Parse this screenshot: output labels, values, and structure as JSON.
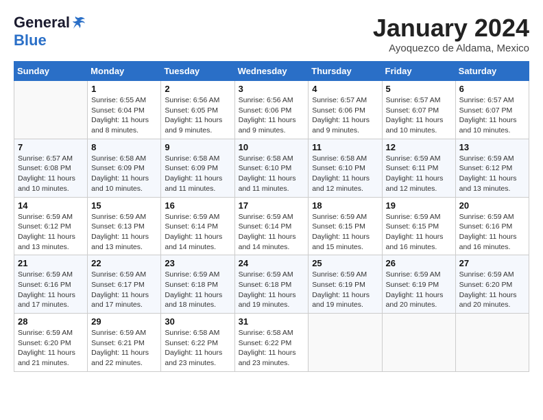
{
  "logo": {
    "general": "General",
    "blue": "Blue"
  },
  "title": "January 2024",
  "location": "Ayoquezco de Aldama, Mexico",
  "weekdays": [
    "Sunday",
    "Monday",
    "Tuesday",
    "Wednesday",
    "Thursday",
    "Friday",
    "Saturday"
  ],
  "weeks": [
    [
      {
        "day": "",
        "sunrise": "",
        "sunset": "",
        "daylight": ""
      },
      {
        "day": "1",
        "sunrise": "Sunrise: 6:55 AM",
        "sunset": "Sunset: 6:04 PM",
        "daylight": "Daylight: 11 hours and 8 minutes."
      },
      {
        "day": "2",
        "sunrise": "Sunrise: 6:56 AM",
        "sunset": "Sunset: 6:05 PM",
        "daylight": "Daylight: 11 hours and 9 minutes."
      },
      {
        "day": "3",
        "sunrise": "Sunrise: 6:56 AM",
        "sunset": "Sunset: 6:06 PM",
        "daylight": "Daylight: 11 hours and 9 minutes."
      },
      {
        "day": "4",
        "sunrise": "Sunrise: 6:57 AM",
        "sunset": "Sunset: 6:06 PM",
        "daylight": "Daylight: 11 hours and 9 minutes."
      },
      {
        "day": "5",
        "sunrise": "Sunrise: 6:57 AM",
        "sunset": "Sunset: 6:07 PM",
        "daylight": "Daylight: 11 hours and 10 minutes."
      },
      {
        "day": "6",
        "sunrise": "Sunrise: 6:57 AM",
        "sunset": "Sunset: 6:07 PM",
        "daylight": "Daylight: 11 hours and 10 minutes."
      }
    ],
    [
      {
        "day": "7",
        "sunrise": "Sunrise: 6:57 AM",
        "sunset": "Sunset: 6:08 PM",
        "daylight": "Daylight: 11 hours and 10 minutes."
      },
      {
        "day": "8",
        "sunrise": "Sunrise: 6:58 AM",
        "sunset": "Sunset: 6:09 PM",
        "daylight": "Daylight: 11 hours and 10 minutes."
      },
      {
        "day": "9",
        "sunrise": "Sunrise: 6:58 AM",
        "sunset": "Sunset: 6:09 PM",
        "daylight": "Daylight: 11 hours and 11 minutes."
      },
      {
        "day": "10",
        "sunrise": "Sunrise: 6:58 AM",
        "sunset": "Sunset: 6:10 PM",
        "daylight": "Daylight: 11 hours and 11 minutes."
      },
      {
        "day": "11",
        "sunrise": "Sunrise: 6:58 AM",
        "sunset": "Sunset: 6:10 PM",
        "daylight": "Daylight: 11 hours and 12 minutes."
      },
      {
        "day": "12",
        "sunrise": "Sunrise: 6:59 AM",
        "sunset": "Sunset: 6:11 PM",
        "daylight": "Daylight: 11 hours and 12 minutes."
      },
      {
        "day": "13",
        "sunrise": "Sunrise: 6:59 AM",
        "sunset": "Sunset: 6:12 PM",
        "daylight": "Daylight: 11 hours and 13 minutes."
      }
    ],
    [
      {
        "day": "14",
        "sunrise": "Sunrise: 6:59 AM",
        "sunset": "Sunset: 6:12 PM",
        "daylight": "Daylight: 11 hours and 13 minutes."
      },
      {
        "day": "15",
        "sunrise": "Sunrise: 6:59 AM",
        "sunset": "Sunset: 6:13 PM",
        "daylight": "Daylight: 11 hours and 13 minutes."
      },
      {
        "day": "16",
        "sunrise": "Sunrise: 6:59 AM",
        "sunset": "Sunset: 6:14 PM",
        "daylight": "Daylight: 11 hours and 14 minutes."
      },
      {
        "day": "17",
        "sunrise": "Sunrise: 6:59 AM",
        "sunset": "Sunset: 6:14 PM",
        "daylight": "Daylight: 11 hours and 14 minutes."
      },
      {
        "day": "18",
        "sunrise": "Sunrise: 6:59 AM",
        "sunset": "Sunset: 6:15 PM",
        "daylight": "Daylight: 11 hours and 15 minutes."
      },
      {
        "day": "19",
        "sunrise": "Sunrise: 6:59 AM",
        "sunset": "Sunset: 6:15 PM",
        "daylight": "Daylight: 11 hours and 16 minutes."
      },
      {
        "day": "20",
        "sunrise": "Sunrise: 6:59 AM",
        "sunset": "Sunset: 6:16 PM",
        "daylight": "Daylight: 11 hours and 16 minutes."
      }
    ],
    [
      {
        "day": "21",
        "sunrise": "Sunrise: 6:59 AM",
        "sunset": "Sunset: 6:16 PM",
        "daylight": "Daylight: 11 hours and 17 minutes."
      },
      {
        "day": "22",
        "sunrise": "Sunrise: 6:59 AM",
        "sunset": "Sunset: 6:17 PM",
        "daylight": "Daylight: 11 hours and 17 minutes."
      },
      {
        "day": "23",
        "sunrise": "Sunrise: 6:59 AM",
        "sunset": "Sunset: 6:18 PM",
        "daylight": "Daylight: 11 hours and 18 minutes."
      },
      {
        "day": "24",
        "sunrise": "Sunrise: 6:59 AM",
        "sunset": "Sunset: 6:18 PM",
        "daylight": "Daylight: 11 hours and 19 minutes."
      },
      {
        "day": "25",
        "sunrise": "Sunrise: 6:59 AM",
        "sunset": "Sunset: 6:19 PM",
        "daylight": "Daylight: 11 hours and 19 minutes."
      },
      {
        "day": "26",
        "sunrise": "Sunrise: 6:59 AM",
        "sunset": "Sunset: 6:19 PM",
        "daylight": "Daylight: 11 hours and 20 minutes."
      },
      {
        "day": "27",
        "sunrise": "Sunrise: 6:59 AM",
        "sunset": "Sunset: 6:20 PM",
        "daylight": "Daylight: 11 hours and 20 minutes."
      }
    ],
    [
      {
        "day": "28",
        "sunrise": "Sunrise: 6:59 AM",
        "sunset": "Sunset: 6:20 PM",
        "daylight": "Daylight: 11 hours and 21 minutes."
      },
      {
        "day": "29",
        "sunrise": "Sunrise: 6:59 AM",
        "sunset": "Sunset: 6:21 PM",
        "daylight": "Daylight: 11 hours and 22 minutes."
      },
      {
        "day": "30",
        "sunrise": "Sunrise: 6:58 AM",
        "sunset": "Sunset: 6:22 PM",
        "daylight": "Daylight: 11 hours and 23 minutes."
      },
      {
        "day": "31",
        "sunrise": "Sunrise: 6:58 AM",
        "sunset": "Sunset: 6:22 PM",
        "daylight": "Daylight: 11 hours and 23 minutes."
      },
      {
        "day": "",
        "sunrise": "",
        "sunset": "",
        "daylight": ""
      },
      {
        "day": "",
        "sunrise": "",
        "sunset": "",
        "daylight": ""
      },
      {
        "day": "",
        "sunrise": "",
        "sunset": "",
        "daylight": ""
      }
    ]
  ]
}
